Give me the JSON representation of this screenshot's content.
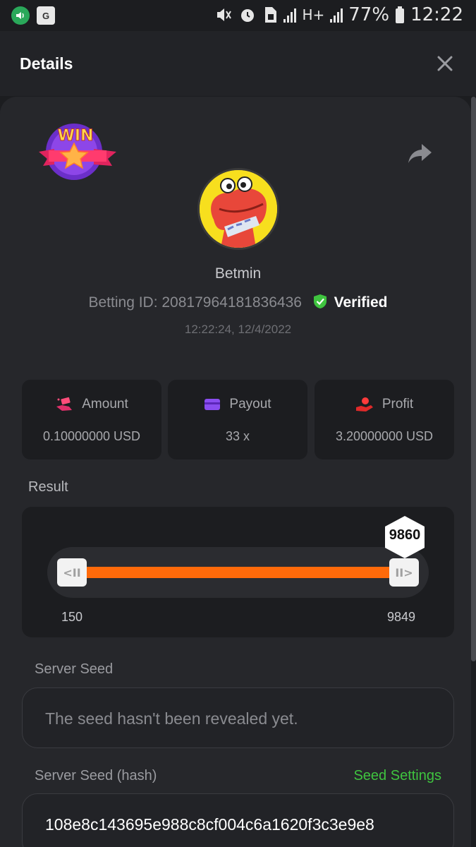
{
  "status_bar": {
    "battery": "77%",
    "time": "12:22",
    "network_label": "H+"
  },
  "header": {
    "title": "Details"
  },
  "bet": {
    "username": "Betmin",
    "betting_id_label": "Betting ID: 20817964181836436",
    "verified_label": "Verified",
    "timestamp": "12:22:24, 12/4/2022",
    "badge_text": "WIN"
  },
  "stats": {
    "amount_label": "Amount",
    "amount_value": "0.10000000 USD",
    "payout_label": "Payout",
    "payout_value": "33 x",
    "profit_label": "Profit",
    "profit_value": "3.20000000 USD"
  },
  "result": {
    "label": "Result",
    "range_min": "150",
    "range_max": "9849",
    "rolled_value": "9860",
    "handle_left_glyph": "<II",
    "handle_right_glyph": "II>"
  },
  "seeds": {
    "server_seed_label": "Server Seed",
    "server_seed_value": "The seed hasn't been revealed yet.",
    "server_seed_hash_label": "Server Seed (hash)",
    "seed_settings_label": "Seed Settings",
    "server_seed_hash_value": "108e8c143695e988c8cf004c6a1620f3c3e9e8"
  },
  "colors": {
    "accent_orange": "#ff6a0a",
    "verified_green": "#3fc43f",
    "background": "#1c1d20",
    "card": "#26272b"
  }
}
